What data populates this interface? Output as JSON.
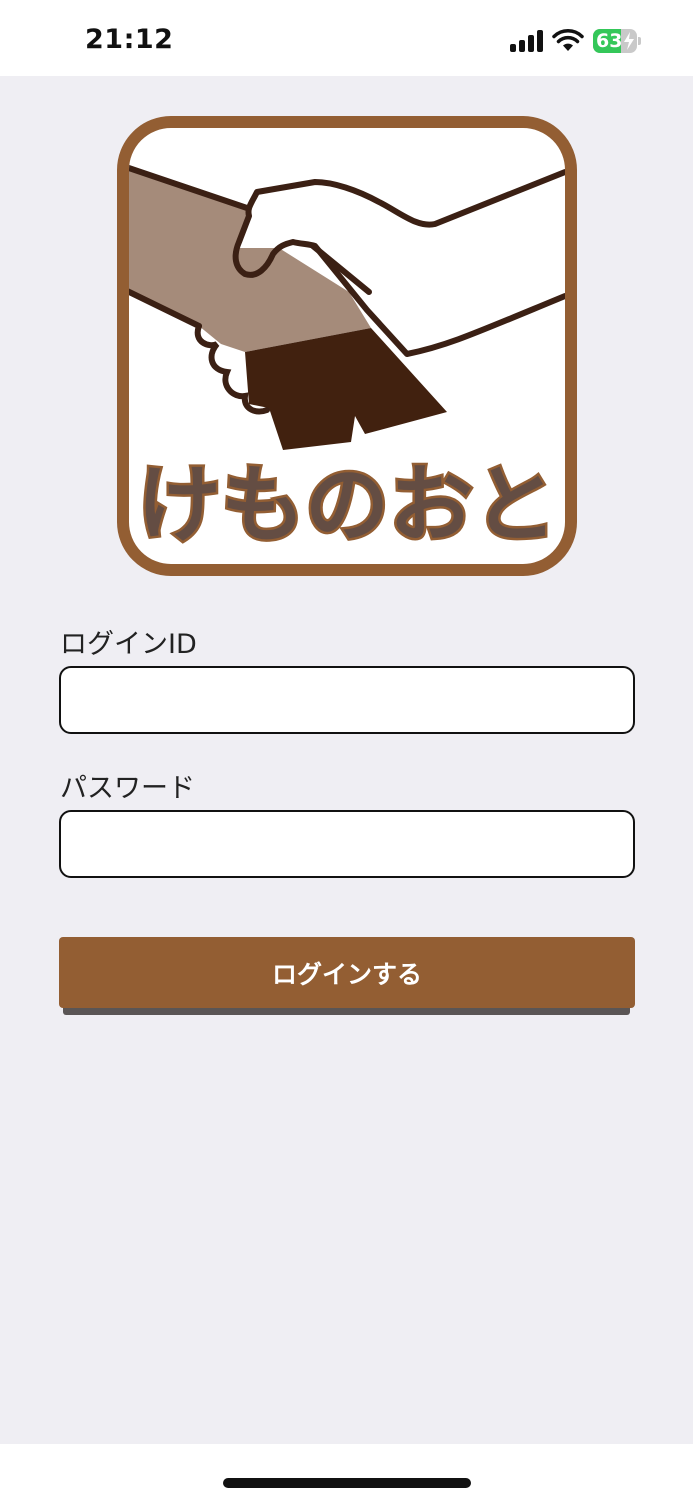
{
  "status_bar": {
    "time": "21:12",
    "battery_percent": "63",
    "battery_level": 0.63,
    "icons": [
      "signal-icon",
      "wifi-icon",
      "battery-icon"
    ]
  },
  "logo": {
    "text": "けものおと",
    "colors": {
      "frame": "#935e33",
      "hand_light": "#a58b7a",
      "hand_dark": "#41210f",
      "outline": "#3b2014",
      "text_fill": "#644d43"
    }
  },
  "form": {
    "login_id_label": "ログインID",
    "login_id_value": "",
    "password_label": "パスワード",
    "password_value": "",
    "submit_label": "ログインする"
  },
  "theme": {
    "background": "#efeef3",
    "accent": "#935e33"
  }
}
